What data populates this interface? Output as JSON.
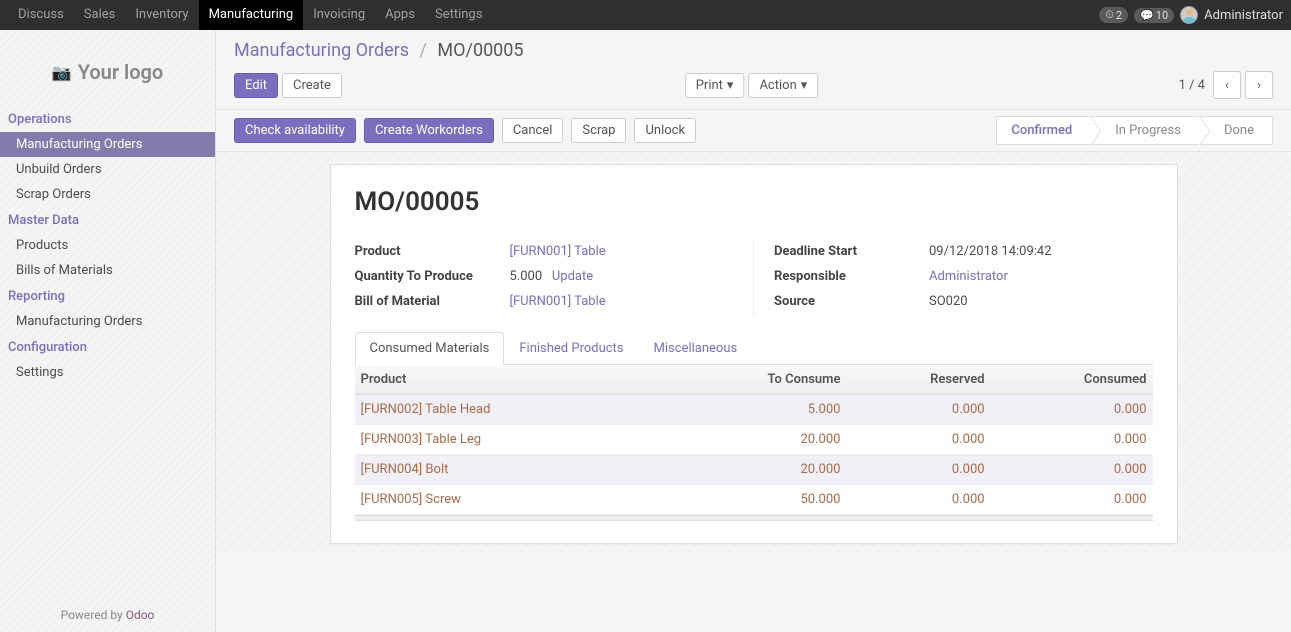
{
  "topbar": {
    "items": [
      "Discuss",
      "Sales",
      "Inventory",
      "Manufacturing",
      "Invoicing",
      "Apps",
      "Settings"
    ],
    "active_index": 3,
    "badge1": "2",
    "badge2": "10",
    "username": "Administrator"
  },
  "logo_text": "Your logo",
  "sidebar": {
    "sections": [
      {
        "title": "Operations",
        "items": [
          "Manufacturing Orders",
          "Unbuild Orders",
          "Scrap Orders"
        ],
        "active_index": 0
      },
      {
        "title": "Master Data",
        "items": [
          "Products",
          "Bills of Materials"
        ]
      },
      {
        "title": "Reporting",
        "items": [
          "Manufacturing Orders"
        ]
      },
      {
        "title": "Configuration",
        "items": [
          "Settings"
        ]
      }
    ],
    "footer_prefix": "Powered by ",
    "footer_brand": "Odoo"
  },
  "breadcrumb": {
    "parent": "Manufacturing Orders",
    "sep": "/",
    "current": "MO/00005"
  },
  "toolbar": {
    "edit": "Edit",
    "create": "Create",
    "print": "Print",
    "action": "Action",
    "pager": "1 / 4"
  },
  "statusbar": {
    "buttons": [
      "Check availability",
      "Create Workorders",
      "Cancel",
      "Scrap",
      "Unlock"
    ],
    "steps": [
      "Confirmed",
      "In Progress",
      "Done"
    ],
    "active_step_index": 0
  },
  "form": {
    "title": "MO/00005",
    "left": {
      "product_label": "Product",
      "product_value": "[FURN001] Table",
      "qty_label": "Quantity To Produce",
      "qty_value": "5.000",
      "qty_update": "Update",
      "bom_label": "Bill of Material",
      "bom_value": "[FURN001] Table"
    },
    "right": {
      "deadline_label": "Deadline Start",
      "deadline_value": "09/12/2018 14:09:42",
      "responsible_label": "Responsible",
      "responsible_value": "Administrator",
      "source_label": "Source",
      "source_value": "SO020"
    },
    "tabs": [
      "Consumed Materials",
      "Finished Products",
      "Miscellaneous"
    ],
    "active_tab_index": 0,
    "table": {
      "headers": [
        "Product",
        "To Consume",
        "Reserved",
        "Consumed"
      ],
      "rows": [
        {
          "product": "[FURN002] Table Head",
          "to_consume": "5.000",
          "reserved": "0.000",
          "consumed": "0.000"
        },
        {
          "product": "[FURN003] Table Leg",
          "to_consume": "20.000",
          "reserved": "0.000",
          "consumed": "0.000"
        },
        {
          "product": "[FURN004] Bolt",
          "to_consume": "20.000",
          "reserved": "0.000",
          "consumed": "0.000"
        },
        {
          "product": "[FURN005] Screw",
          "to_consume": "50.000",
          "reserved": "0.000",
          "consumed": "0.000"
        }
      ]
    }
  }
}
